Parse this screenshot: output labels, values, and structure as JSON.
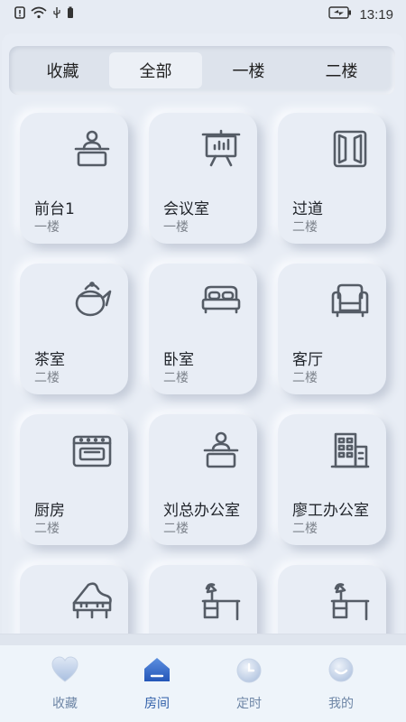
{
  "status_bar": {
    "time": "13:19"
  },
  "tabs": [
    {
      "label": "收藏",
      "active": false
    },
    {
      "label": "全部",
      "active": true
    },
    {
      "label": "一楼",
      "active": false
    },
    {
      "label": "二楼",
      "active": false
    }
  ],
  "rooms": [
    {
      "name": "前台1",
      "floor": "一楼",
      "icon": "reception-desk-icon"
    },
    {
      "name": "会议室",
      "floor": "一楼",
      "icon": "presentation-board-icon"
    },
    {
      "name": "过道",
      "floor": "二楼",
      "icon": "door-corridor-icon"
    },
    {
      "name": "茶室",
      "floor": "二楼",
      "icon": "teapot-icon"
    },
    {
      "name": "卧室",
      "floor": "二楼",
      "icon": "bed-icon"
    },
    {
      "name": "客厅",
      "floor": "二楼",
      "icon": "armchair-icon"
    },
    {
      "name": "厨房",
      "floor": "二楼",
      "icon": "stove-icon"
    },
    {
      "name": "刘总办公室",
      "floor": "二楼",
      "icon": "reception-desk-icon"
    },
    {
      "name": "廖工办公室",
      "floor": "二楼",
      "icon": "office-building-icon"
    },
    {
      "name": "",
      "floor": "",
      "icon": "piano-icon"
    },
    {
      "name": "",
      "floor": "",
      "icon": "desk-lamp-icon"
    },
    {
      "name": "",
      "floor": "",
      "icon": "desk-lamp-icon"
    }
  ],
  "bottom_nav": [
    {
      "label": "收藏",
      "icon": "heart-icon",
      "active": false
    },
    {
      "label": "房间",
      "icon": "home-icon",
      "active": true
    },
    {
      "label": "定时",
      "icon": "clock-icon",
      "active": false
    },
    {
      "label": "我的",
      "icon": "smile-icon",
      "active": false
    }
  ],
  "colors": {
    "accent": "#2f5ea8",
    "background": "#e6ebf3",
    "nav_inactive": "#6e86a6"
  }
}
